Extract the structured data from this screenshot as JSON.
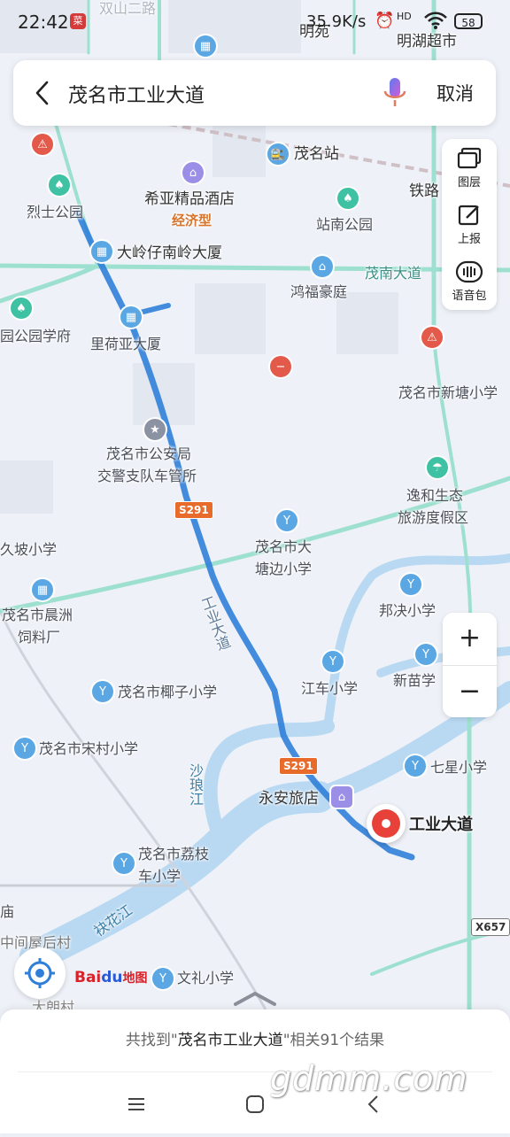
{
  "status_bar": {
    "time": "22:42",
    "notification": "菜",
    "network_speed": "35.9K/s",
    "signal": "HD",
    "battery": "58"
  },
  "search": {
    "query": "茂名市工业大道",
    "cancel_label": "取消",
    "back_icon": "back-arrow-icon",
    "voice_icon": "microphone-icon"
  },
  "side_tools": [
    {
      "label": "图层",
      "icon": "layers-icon"
    },
    {
      "label": "上报",
      "icon": "report-edit-icon"
    },
    {
      "label": "语音包",
      "icon": "voice-pack-icon"
    }
  ],
  "zoom": {
    "in": "+",
    "out": "−"
  },
  "map": {
    "colors": {
      "route": "#2f7fd9",
      "road": "#9ee0cf",
      "water": "#b9d9f2",
      "background": "#eef2f8",
      "pin": "#e8413a"
    },
    "top_labels": [
      "双山二路",
      "明苑",
      "明湖超市"
    ],
    "labels": {
      "maoming_station": "茂名站",
      "tielu": "铁路",
      "lieshi_park": "烈士公园",
      "xiya_hotel": "希亚精品酒店",
      "economy": "经济型",
      "zhannan_park": "站南公园",
      "daling": "大岭仔南岭大厦",
      "maonan_road": "茂南大道",
      "hongfu": "鸿福豪庭",
      "park_school": "园公园学府",
      "liheya": "里荷亚大厦",
      "xintang": "茂名市新塘小学",
      "police_1": "茂名市公安局",
      "police_2": "交警支队车管所",
      "yihe_1": "逸和生态",
      "yihe_2": "旅游度假区",
      "jiupo": "久坡小学",
      "tangbian_1": "茂名市大",
      "tangbian_2": "塘边小学",
      "chenzhou_1": "茂名市晨洲",
      "chenzhou_2": "饲料厂",
      "bangjue": "邦决小学",
      "gongye_road": "工业大道",
      "jiangche": "江车小学",
      "xinmiao": "新苗学",
      "yezi": "茂名市椰子小学",
      "songcun": "茂名市宋村小学",
      "qixing": "七星小学",
      "shalang_river": "沙琅江",
      "yongan": "永安旅店",
      "lizhi_1": "茂名市荔枝",
      "lizhi_2": "车小学",
      "miao": "庙",
      "zhongjian": "中间屋后村",
      "dalang": "大朗村",
      "jianjiang": "袂花江",
      "wenli": "文礼小学",
      "s291_1": "S291",
      "s291_2": "S291",
      "x657": "X657"
    },
    "destination": "工业大道"
  },
  "logo": {
    "bai": "Bai",
    "du": "du",
    "ditu": "地图"
  },
  "result": {
    "prefix": "共找到\"",
    "keyword": "茂名市工业大道",
    "suffix": "\"相关91个结果"
  },
  "watermark": "gdmm.com",
  "nav": [
    "menu-icon",
    "home-icon",
    "back-icon"
  ]
}
